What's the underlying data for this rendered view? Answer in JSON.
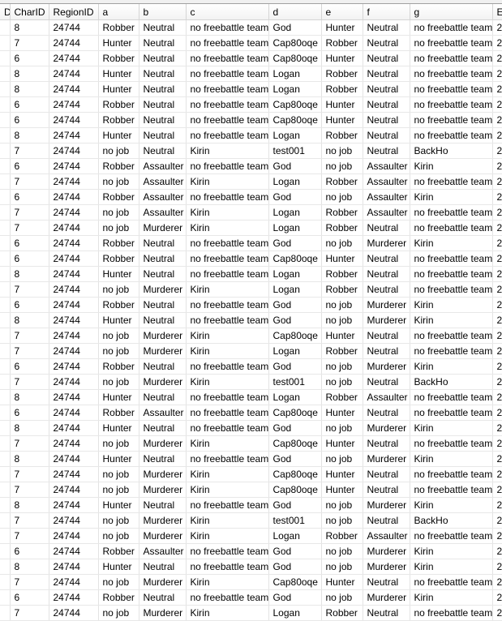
{
  "grid": {
    "columns": [
      "D",
      "CharID",
      "RegionID",
      "a",
      "b",
      "c",
      "d",
      "e",
      "f",
      "g",
      "E"
    ],
    "rows": [
      [
        "",
        "8",
        "24744",
        "Robber",
        "Neutral",
        "no freebattle team",
        "God",
        "Hunter",
        "Neutral",
        "no freebattle team",
        "2"
      ],
      [
        "",
        "7",
        "24744",
        "Hunter",
        "Neutral",
        "no freebattle team",
        "Cap80oqe",
        "Robber",
        "Neutral",
        "no freebattle team",
        "2"
      ],
      [
        "",
        "6",
        "24744",
        "Robber",
        "Neutral",
        "no freebattle team",
        "Cap80oqe",
        "Hunter",
        "Neutral",
        "no freebattle team",
        "2"
      ],
      [
        "",
        "8",
        "24744",
        "Hunter",
        "Neutral",
        "no freebattle team",
        "Logan",
        "Robber",
        "Neutral",
        "no freebattle team",
        "2"
      ],
      [
        "",
        "8",
        "24744",
        "Hunter",
        "Neutral",
        "no freebattle team",
        "Logan",
        "Robber",
        "Neutral",
        "no freebattle team",
        "2"
      ],
      [
        "",
        "6",
        "24744",
        "Robber",
        "Neutral",
        "no freebattle team",
        "Cap80oqe",
        "Hunter",
        "Neutral",
        "no freebattle team",
        "2"
      ],
      [
        "",
        "6",
        "24744",
        "Robber",
        "Neutral",
        "no freebattle team",
        "Cap80oqe",
        "Hunter",
        "Neutral",
        "no freebattle team",
        "2"
      ],
      [
        "",
        "8",
        "24744",
        "Hunter",
        "Neutral",
        "no freebattle team",
        "Logan",
        "Robber",
        "Neutral",
        "no freebattle team",
        "2"
      ],
      [
        "",
        "7",
        "24744",
        "no job",
        "Neutral",
        "Kirin",
        "test001",
        "no job",
        "Neutral",
        "BackHo",
        "2"
      ],
      [
        "",
        "6",
        "24744",
        "Robber",
        "Assaulter",
        "no freebattle team",
        "God",
        "no job",
        "Assaulter",
        "Kirin",
        "2"
      ],
      [
        "",
        "7",
        "24744",
        "no job",
        "Assaulter",
        "Kirin",
        "Logan",
        "Robber",
        "Assaulter",
        "no freebattle team",
        "2"
      ],
      [
        "",
        "6",
        "24744",
        "Robber",
        "Assaulter",
        "no freebattle team",
        "God",
        "no job",
        "Assaulter",
        "Kirin",
        "2"
      ],
      [
        "",
        "7",
        "24744",
        "no job",
        "Assaulter",
        "Kirin",
        "Logan",
        "Robber",
        "Assaulter",
        "no freebattle team",
        "2"
      ],
      [
        "",
        "7",
        "24744",
        "no job",
        "Murderer",
        "Kirin",
        "Logan",
        "Robber",
        "Neutral",
        "no freebattle team",
        "2"
      ],
      [
        "",
        "6",
        "24744",
        "Robber",
        "Neutral",
        "no freebattle team",
        "God",
        "no job",
        "Murderer",
        "Kirin",
        "2"
      ],
      [
        "",
        "6",
        "24744",
        "Robber",
        "Neutral",
        "no freebattle team",
        "Cap80oqe",
        "Hunter",
        "Neutral",
        "no freebattle team",
        "2"
      ],
      [
        "",
        "8",
        "24744",
        "Hunter",
        "Neutral",
        "no freebattle team",
        "Logan",
        "Robber",
        "Neutral",
        "no freebattle team",
        "2"
      ],
      [
        "",
        "7",
        "24744",
        "no job",
        "Murderer",
        "Kirin",
        "Logan",
        "Robber",
        "Neutral",
        "no freebattle team",
        "2"
      ],
      [
        "",
        "6",
        "24744",
        "Robber",
        "Neutral",
        "no freebattle team",
        "God",
        "no job",
        "Murderer",
        "Kirin",
        "2"
      ],
      [
        "",
        "8",
        "24744",
        "Hunter",
        "Neutral",
        "no freebattle team",
        "God",
        "no job",
        "Murderer",
        "Kirin",
        "2"
      ],
      [
        "",
        "7",
        "24744",
        "no job",
        "Murderer",
        "Kirin",
        "Cap80oqe",
        "Hunter",
        "Neutral",
        "no freebattle team",
        "2"
      ],
      [
        "",
        "7",
        "24744",
        "no job",
        "Murderer",
        "Kirin",
        "Logan",
        "Robber",
        "Neutral",
        "no freebattle team",
        "2"
      ],
      [
        "",
        "6",
        "24744",
        "Robber",
        "Neutral",
        "no freebattle team",
        "God",
        "no job",
        "Murderer",
        "Kirin",
        "2"
      ],
      [
        "",
        "7",
        "24744",
        "no job",
        "Murderer",
        "Kirin",
        "test001",
        "no job",
        "Neutral",
        "BackHo",
        "2"
      ],
      [
        "",
        "8",
        "24744",
        "Hunter",
        "Neutral",
        "no freebattle team",
        "Logan",
        "Robber",
        "Assaulter",
        "no freebattle team",
        "2"
      ],
      [
        "",
        "6",
        "24744",
        "Robber",
        "Assaulter",
        "no freebattle team",
        "Cap80oqe",
        "Hunter",
        "Neutral",
        "no freebattle team",
        "2"
      ],
      [
        "",
        "8",
        "24744",
        "Hunter",
        "Neutral",
        "no freebattle team",
        "God",
        "no job",
        "Murderer",
        "Kirin",
        "2"
      ],
      [
        "",
        "7",
        "24744",
        "no job",
        "Murderer",
        "Kirin",
        "Cap80oqe",
        "Hunter",
        "Neutral",
        "no freebattle team",
        "2"
      ],
      [
        "",
        "8",
        "24744",
        "Hunter",
        "Neutral",
        "no freebattle team",
        "God",
        "no job",
        "Murderer",
        "Kirin",
        "2"
      ],
      [
        "",
        "7",
        "24744",
        "no job",
        "Murderer",
        "Kirin",
        "Cap80oqe",
        "Hunter",
        "Neutral",
        "no freebattle team",
        "2"
      ],
      [
        "",
        "7",
        "24744",
        "no job",
        "Murderer",
        "Kirin",
        "Cap80oqe",
        "Hunter",
        "Neutral",
        "no freebattle team",
        "2"
      ],
      [
        "",
        "8",
        "24744",
        "Hunter",
        "Neutral",
        "no freebattle team",
        "God",
        "no job",
        "Murderer",
        "Kirin",
        "2"
      ],
      [
        "",
        "7",
        "24744",
        "no job",
        "Murderer",
        "Kirin",
        "test001",
        "no job",
        "Neutral",
        "BackHo",
        "2"
      ],
      [
        "",
        "7",
        "24744",
        "no job",
        "Murderer",
        "Kirin",
        "Logan",
        "Robber",
        "Assaulter",
        "no freebattle team",
        "2"
      ],
      [
        "",
        "6",
        "24744",
        "Robber",
        "Assaulter",
        "no freebattle team",
        "God",
        "no job",
        "Murderer",
        "Kirin",
        "2"
      ],
      [
        "",
        "8",
        "24744",
        "Hunter",
        "Neutral",
        "no freebattle team",
        "God",
        "no job",
        "Murderer",
        "Kirin",
        "2"
      ],
      [
        "",
        "7",
        "24744",
        "no job",
        "Murderer",
        "Kirin",
        "Cap80oqe",
        "Hunter",
        "Neutral",
        "no freebattle team",
        "2"
      ],
      [
        "",
        "6",
        "24744",
        "Robber",
        "Neutral",
        "no freebattle team",
        "God",
        "no job",
        "Murderer",
        "Kirin",
        "2"
      ],
      [
        "",
        "7",
        "24744",
        "no job",
        "Murderer",
        "Kirin",
        "Logan",
        "Robber",
        "Neutral",
        "no freebattle team",
        "2"
      ]
    ]
  }
}
